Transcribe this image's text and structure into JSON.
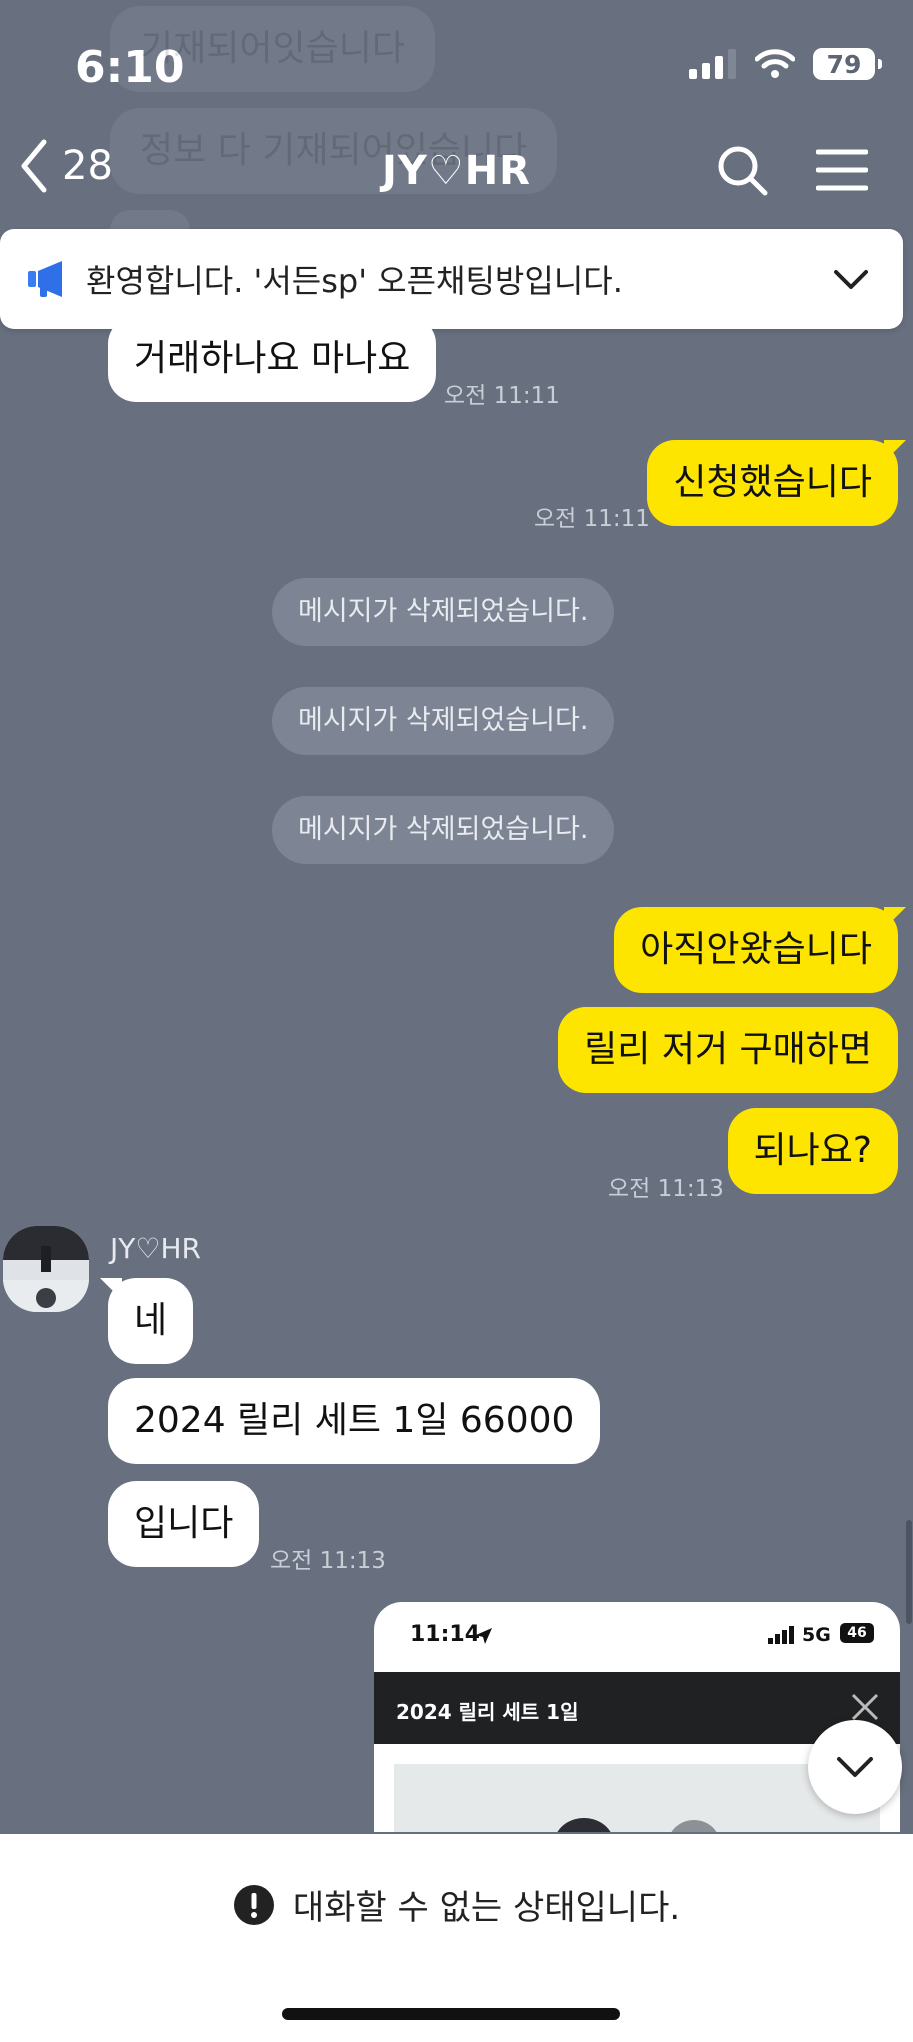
{
  "status": {
    "time": "6:10",
    "battery": "79"
  },
  "ghost_messages": [
    "기재되어잇습니다",
    "정보 다 기재되어있습니다"
  ],
  "header": {
    "back_count": "28",
    "title": "JY♡HR"
  },
  "notice": {
    "text": "환영합니다. '서든sp' 오픈채팅방입니다."
  },
  "messages": {
    "m1": {
      "text": "거래하나요 마나요",
      "time": "오전 11:11"
    },
    "m2": {
      "text": "신청했습니다",
      "time": "오전 11:11"
    },
    "deleted": [
      "메시지가 삭제되었습니다.",
      "메시지가 삭제되었습니다.",
      "메시지가 삭제되었습니다."
    ],
    "m3": {
      "text": "아직안왔습니다"
    },
    "m4": {
      "text": "릴리 저거 구매하면"
    },
    "m5": {
      "text": "되나요?",
      "time": "오전 11:13"
    },
    "sender_name": "JY♡HR",
    "m6": {
      "text": "네"
    },
    "m7": {
      "text": "2024 릴리 세트 1일 66000"
    },
    "m8": {
      "text": "입니다",
      "time": "오전 11:13"
    }
  },
  "shared_image": {
    "time": "11:14",
    "network": "5G",
    "battery": "46",
    "title": "2024 릴리 세트 1일"
  },
  "bottom": {
    "disabled_text": "대화할 수 없는 상태입니다."
  }
}
